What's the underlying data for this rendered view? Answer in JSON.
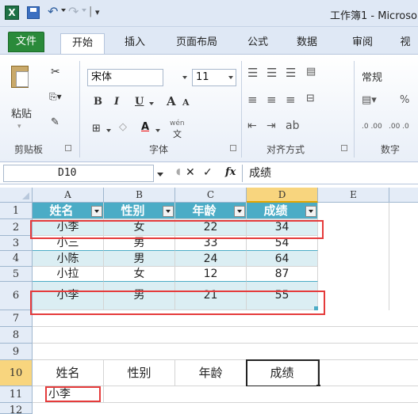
{
  "app": {
    "title": "工作簿1 - Microso",
    "logo_letter": "X",
    "quick_access_sep": "|",
    "quick_access_more": "▾"
  },
  "tabs": [
    {
      "label": "文件"
    },
    {
      "label": "开始"
    },
    {
      "label": "插入"
    },
    {
      "label": "页面布局"
    },
    {
      "label": "公式"
    },
    {
      "label": "数据"
    },
    {
      "label": "审阅"
    },
    {
      "label": "视"
    }
  ],
  "ribbon": {
    "clipboard": {
      "label": "剪贴板",
      "paste": "粘贴"
    },
    "font": {
      "label": "字体",
      "font_name": "宋体",
      "font_size": "11",
      "bold": "B",
      "italic": "I",
      "underline": "U",
      "grow": "A",
      "shrink": "A",
      "phonetic": "wén"
    },
    "alignment": {
      "label": "对齐方式"
    },
    "number": {
      "label": "数字",
      "format": "常规",
      "percent": "%",
      "inc_decimal": ".0 .00",
      "dec_decimal": ".00 .0"
    }
  },
  "formula_bar": {
    "name_box": "D10",
    "fx": "fx",
    "cancel": "✕",
    "enter": "✓",
    "value": "成绩"
  },
  "sheet": {
    "columns": [
      "A",
      "B",
      "C",
      "D",
      "E"
    ],
    "selected_column": "D",
    "rows": [
      "1",
      "2",
      "3",
      "4",
      "5",
      "6",
      "7",
      "8",
      "9",
      "10",
      "11",
      "12"
    ],
    "selected_row": "10",
    "table_header": [
      "姓名",
      "性别",
      "年龄",
      "成绩"
    ],
    "table_rows": [
      [
        "小李",
        "女",
        "22",
        "34"
      ],
      [
        "小三",
        "男",
        "33",
        "54"
      ],
      [
        "小陈",
        "男",
        "24",
        "64"
      ],
      [
        "小拉",
        "女",
        "12",
        "87"
      ],
      [
        "小李",
        "男",
        "21",
        "55"
      ]
    ],
    "criteria_header": [
      "姓名",
      "性别",
      "年龄",
      "成绩"
    ],
    "criteria_value": "小李"
  }
}
